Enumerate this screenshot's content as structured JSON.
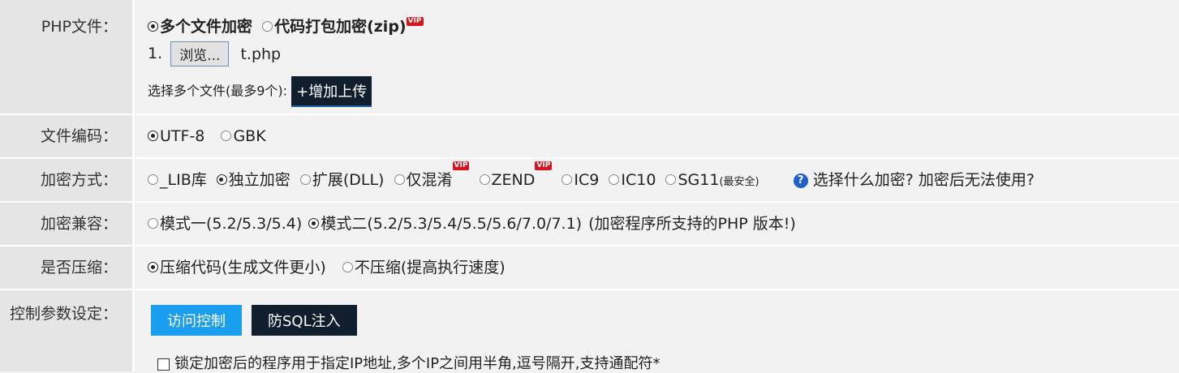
{
  "php_file": {
    "label": "PHP文件：",
    "mode_multi": "多个文件加密",
    "mode_zip": "代码打包加密(zip)",
    "vip": "VIP",
    "index": "1.",
    "browse": "浏览...",
    "filename": "t.php",
    "select_hint": "选择多个文件(最多9个):",
    "add_upload": "+增加上传"
  },
  "encoding": {
    "label": "文件编码：",
    "options": [
      "UTF-8",
      "GBK"
    ],
    "selected": "UTF-8"
  },
  "encrypt_method": {
    "label": "加密方式：",
    "options": [
      "_LIB库",
      "独立加密",
      "扩展(DLL)",
      "仅混淆",
      "ZEND",
      "IC9",
      "IC10",
      "SG11"
    ],
    "sg11_note": "(最安全)",
    "help_link": "选择什么加密?",
    "help_link2": "加密后无法使用?",
    "selected": "独立加密"
  },
  "compat": {
    "label": "加密兼容：",
    "mode1": "模式一(5.2/5.3/5.4)",
    "mode2": "模式二(5.2/5.3/5.4/5.5/5.6/7.0/7.1)",
    "note": "(加密程序所支持的PHP 版本!)"
  },
  "compress": {
    "label": "是否压缩：",
    "yes": "压缩代码(生成文件更小)",
    "no": "不压缩(提高执行速度)"
  },
  "control": {
    "label": "控制参数设定：",
    "tab_access": "访问控制",
    "tab_sql": "防SQL注入",
    "ip_lock": "锁定加密后的程序用于指定IP地址,多个IP之间用半角,逗号隔开,支持通配符*"
  }
}
